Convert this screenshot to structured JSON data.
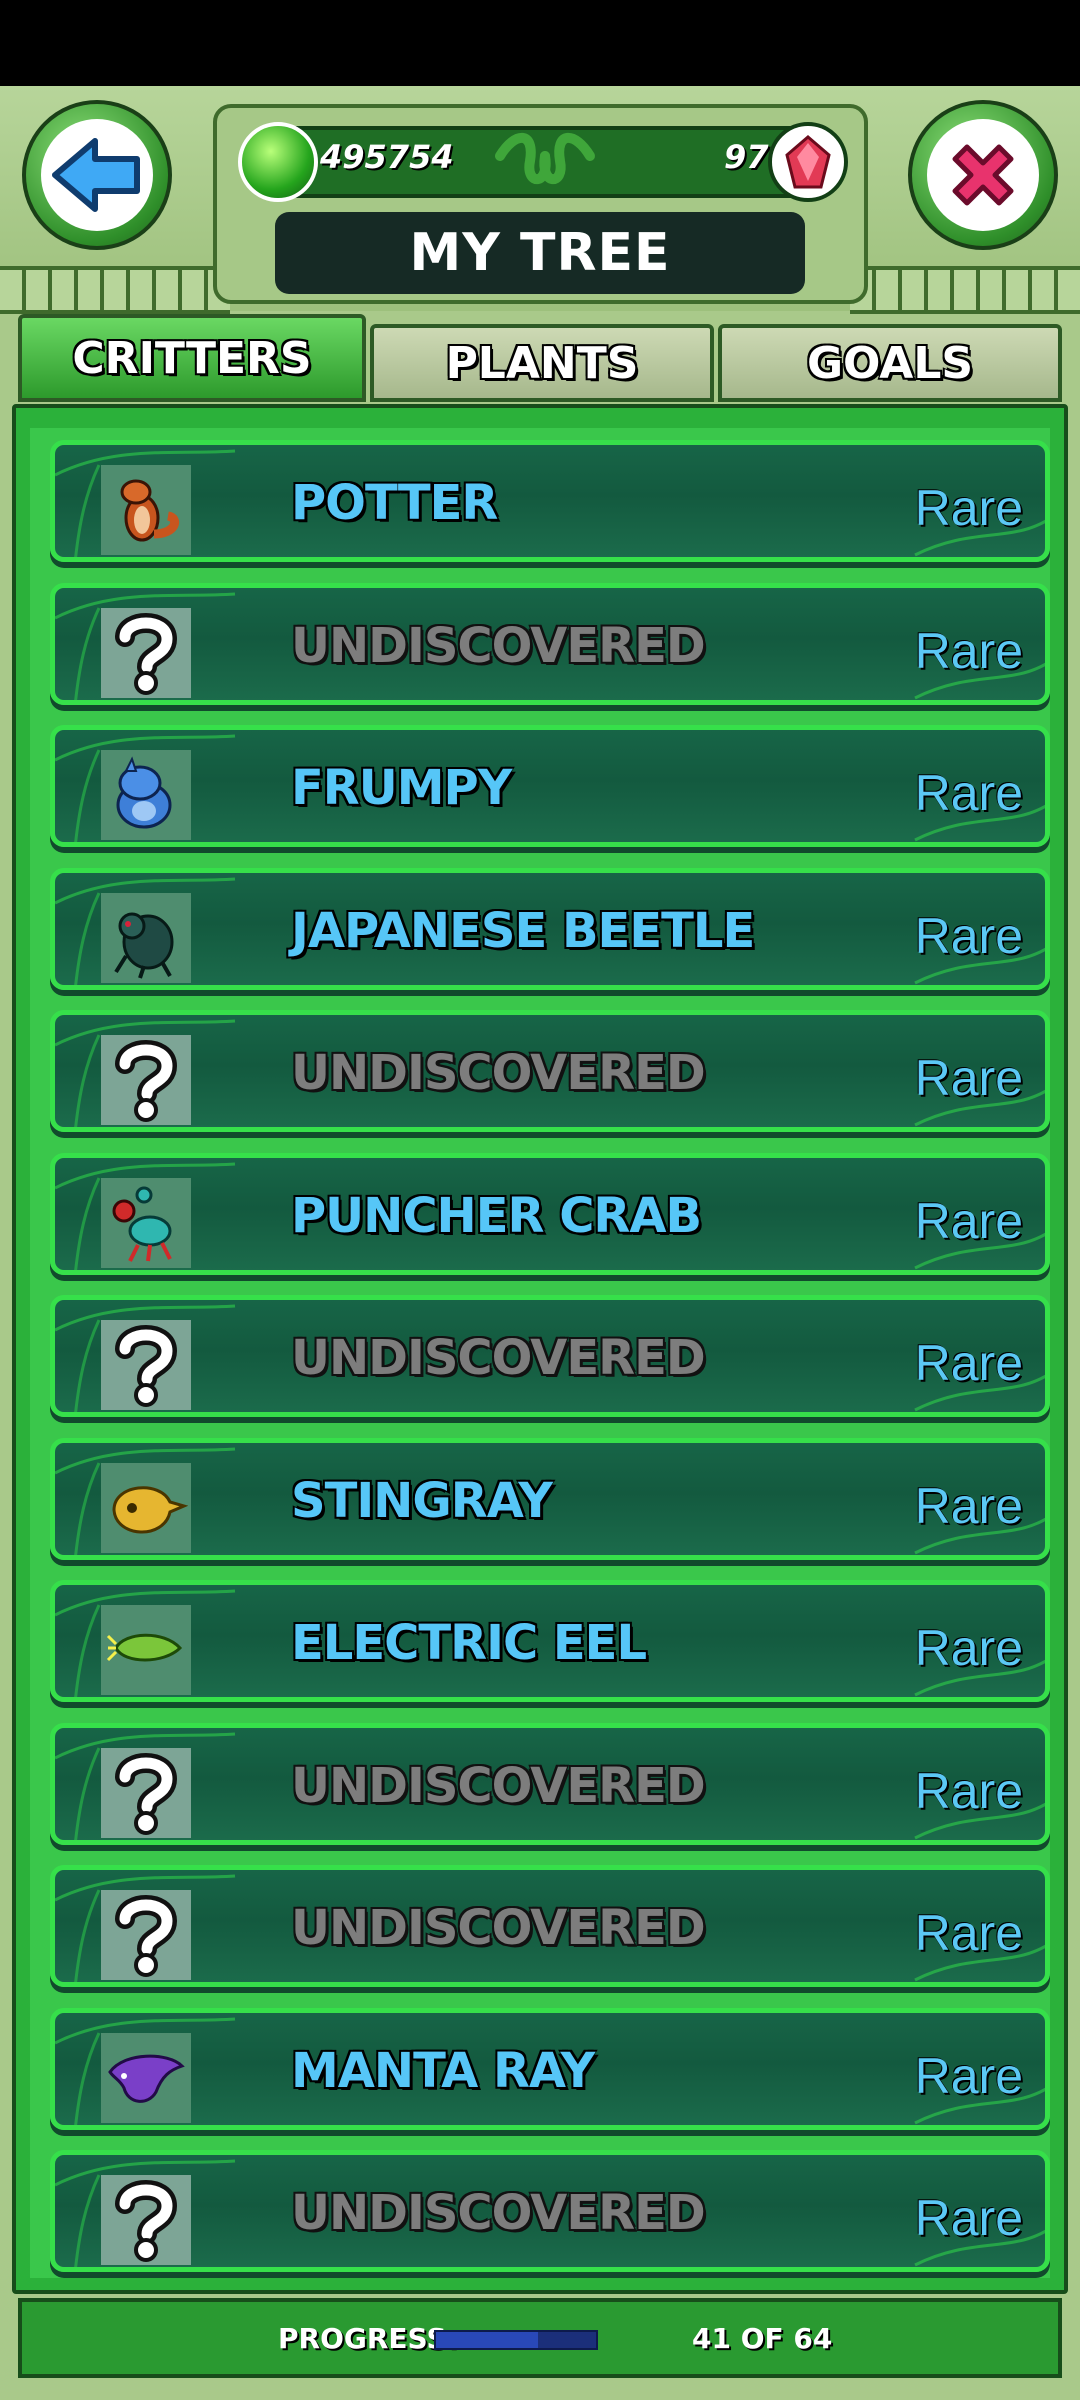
{
  "header": {
    "title": "MY TREE",
    "gel_count": "495754",
    "gem_count": "97"
  },
  "tabs": [
    {
      "label": "CRITTERS",
      "active": true
    },
    {
      "label": "PLANTS",
      "active": false
    },
    {
      "label": "GOALS",
      "active": false
    }
  ],
  "critters": [
    {
      "name": "POTTER",
      "rarity": "Rare",
      "discovered": true,
      "icon": "otter-icon"
    },
    {
      "name": "UNDISCOVERED",
      "rarity": "Rare",
      "discovered": false,
      "icon": "question-mark-icon"
    },
    {
      "name": "FRUMPY",
      "rarity": "Rare",
      "discovered": true,
      "icon": "frumpy-icon"
    },
    {
      "name": "JAPANESE BEETLE",
      "rarity": "Rare",
      "discovered": true,
      "icon": "beetle-icon"
    },
    {
      "name": "UNDISCOVERED",
      "rarity": "Rare",
      "discovered": false,
      "icon": "question-mark-icon"
    },
    {
      "name": "PUNCHER CRAB",
      "rarity": "Rare",
      "discovered": true,
      "icon": "crab-icon"
    },
    {
      "name": "UNDISCOVERED",
      "rarity": "Rare",
      "discovered": false,
      "icon": "question-mark-icon"
    },
    {
      "name": "STINGRAY",
      "rarity": "Rare",
      "discovered": true,
      "icon": "stingray-icon"
    },
    {
      "name": "ELECTRIC EEL",
      "rarity": "Rare",
      "discovered": true,
      "icon": "eel-icon"
    },
    {
      "name": "UNDISCOVERED",
      "rarity": "Rare",
      "discovered": false,
      "icon": "question-mark-icon"
    },
    {
      "name": "UNDISCOVERED",
      "rarity": "Rare",
      "discovered": false,
      "icon": "question-mark-icon"
    },
    {
      "name": "MANTA RAY",
      "rarity": "Rare",
      "discovered": true,
      "icon": "manta-ray-icon"
    },
    {
      "name": "UNDISCOVERED",
      "rarity": "Rare",
      "discovered": false,
      "icon": "question-mark-icon"
    }
  ],
  "footer": {
    "progress_label": "PROGRESS:",
    "progress_text": "41 OF 64",
    "progress_fraction": 0.64
  },
  "colors": {
    "accent_green": "#2bb13a",
    "name_blue": "#56c6f7",
    "undiscovered_gray": "#7d7d7d",
    "back_blue": "#3fa9f5",
    "close_pink": "#e8336d"
  }
}
